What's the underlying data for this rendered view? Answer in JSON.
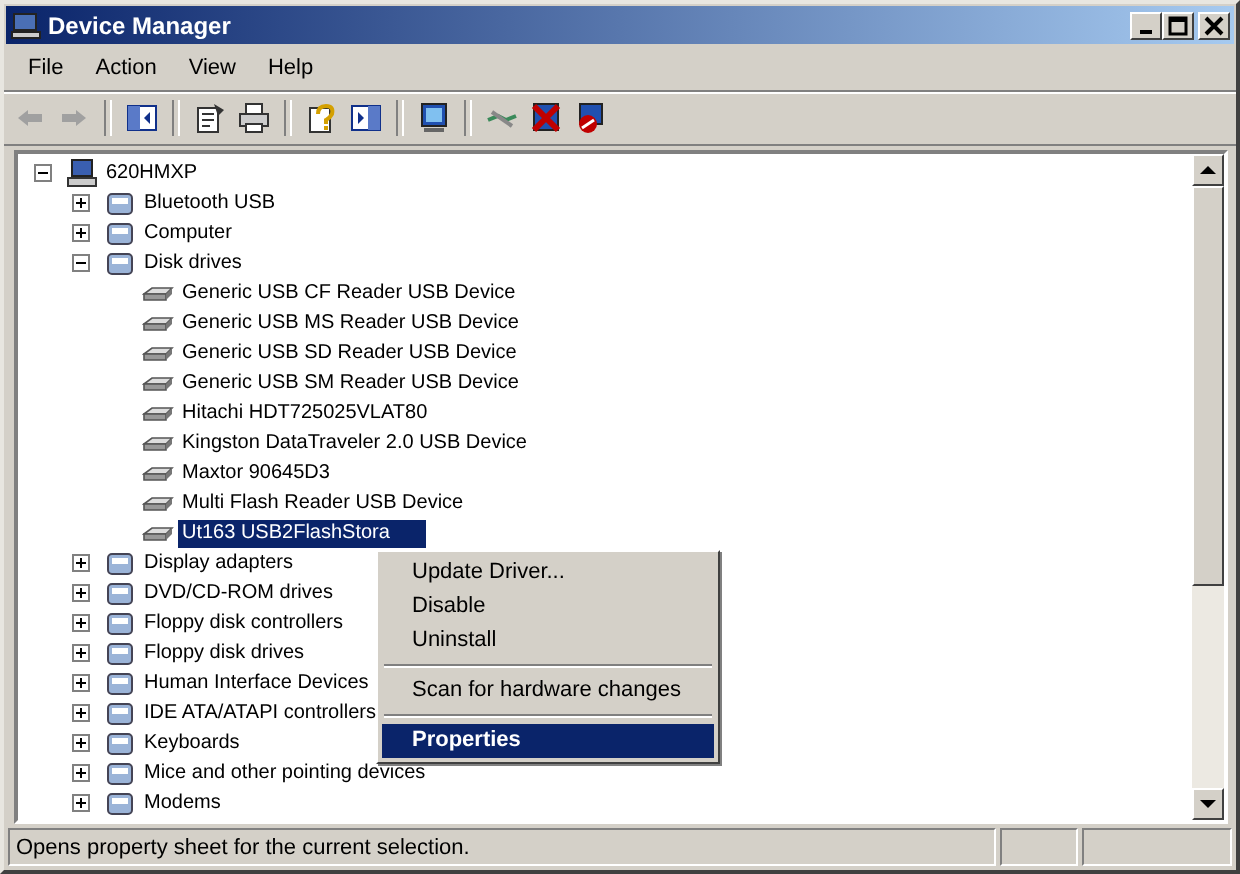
{
  "window": {
    "title": "Device Manager"
  },
  "menu": [
    "File",
    "Action",
    "View",
    "Help"
  ],
  "tree": {
    "label": "620HMXP",
    "expanded": true,
    "selected": false,
    "children": [
      {
        "label": "Bluetooth USB",
        "expanded": false,
        "selected": false
      },
      {
        "label": "Computer",
        "expanded": false,
        "selected": false
      },
      {
        "label": "Disk drives",
        "expanded": true,
        "selected": false,
        "children": [
          {
            "label": "Generic USB CF Reader USB Device",
            "selected": false
          },
          {
            "label": "Generic USB MS Reader USB Device",
            "selected": false
          },
          {
            "label": "Generic USB SD Reader USB Device",
            "selected": false
          },
          {
            "label": "Generic USB SM Reader USB Device",
            "selected": false
          },
          {
            "label": "Hitachi HDT725025VLAT80",
            "selected": false
          },
          {
            "label": "Kingston DataTraveler 2.0 USB Device",
            "selected": false
          },
          {
            "label": "Maxtor 90645D3",
            "selected": false
          },
          {
            "label": "Multi Flash Reader USB Device",
            "selected": false
          },
          {
            "label": "Ut163 USB2FlashStora",
            "selected": true
          }
        ]
      },
      {
        "label": "Display adapters",
        "expanded": false,
        "selected": false
      },
      {
        "label": "DVD/CD-ROM drives",
        "expanded": false,
        "selected": false
      },
      {
        "label": "Floppy disk controllers",
        "expanded": false,
        "selected": false
      },
      {
        "label": "Floppy disk drives",
        "expanded": false,
        "selected": false
      },
      {
        "label": "Human Interface Devices",
        "expanded": false,
        "selected": false
      },
      {
        "label": "IDE ATA/ATAPI controllers",
        "expanded": false,
        "selected": false
      },
      {
        "label": "Keyboards",
        "expanded": false,
        "selected": false
      },
      {
        "label": "Mice and other pointing devices",
        "expanded": false,
        "selected": false
      },
      {
        "label": "Modems",
        "expanded": false,
        "selected": false
      }
    ]
  },
  "context_menu": {
    "items": [
      {
        "kind": "item",
        "label": "Update Driver...",
        "selected": false,
        "default": false
      },
      {
        "kind": "item",
        "label": "Disable",
        "selected": false,
        "default": false
      },
      {
        "kind": "item",
        "label": "Uninstall",
        "selected": false,
        "default": false
      },
      {
        "kind": "separator"
      },
      {
        "kind": "item",
        "label": "Scan for hardware changes",
        "selected": false,
        "default": false
      },
      {
        "kind": "separator"
      },
      {
        "kind": "item",
        "label": "Properties",
        "selected": true,
        "default": true
      }
    ]
  },
  "status_bar": "Opens property sheet for the current selection."
}
